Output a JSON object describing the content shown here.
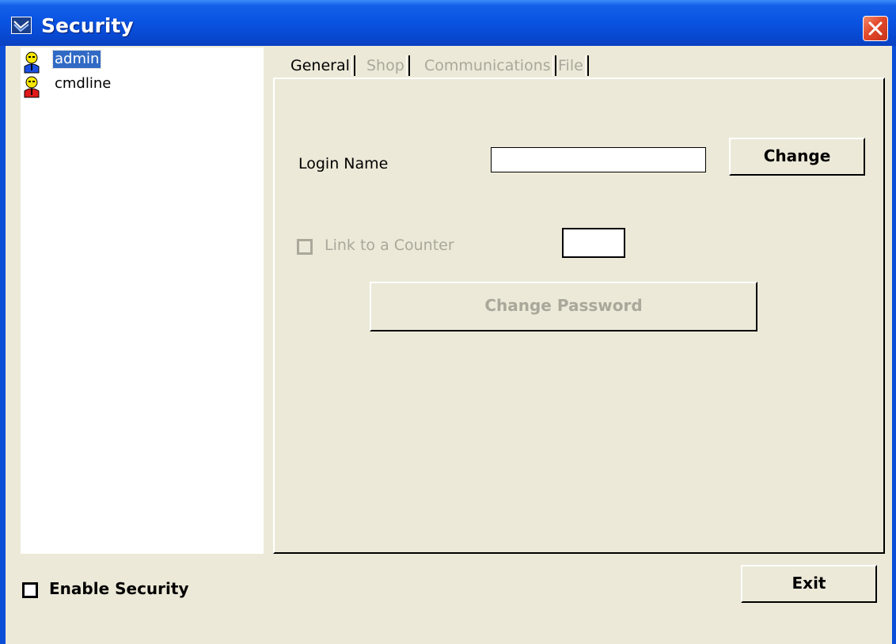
{
  "window": {
    "title": "Security",
    "icon": "security-app-icon",
    "close_icon": "close-icon"
  },
  "users": [
    {
      "name": "admin",
      "icon": "user-icon-blue",
      "selected": true
    },
    {
      "name": "cmdline",
      "icon": "user-icon-red",
      "selected": false
    }
  ],
  "tabs": [
    {
      "label": "General",
      "active": true
    },
    {
      "label": "Shop",
      "active": false
    },
    {
      "label": "Communications",
      "active": false
    },
    {
      "label": "File",
      "active": false
    }
  ],
  "general": {
    "login_name_label": "Login Name",
    "login_name_value": "",
    "change_button": "Change",
    "link_counter_label": "Link to a Counter",
    "link_counter_checked": false,
    "counter_value": "",
    "change_password_button": "Change Password"
  },
  "footer": {
    "enable_security_label": "Enable Security",
    "enable_security_checked": false,
    "exit_button": "Exit"
  },
  "colors": {
    "titlebar": "#0a54e3",
    "selection": "#316ac5",
    "dialog_bg": "#ece9d8",
    "close_button": "#e2492a",
    "disabled_text": "#a9a89a"
  }
}
